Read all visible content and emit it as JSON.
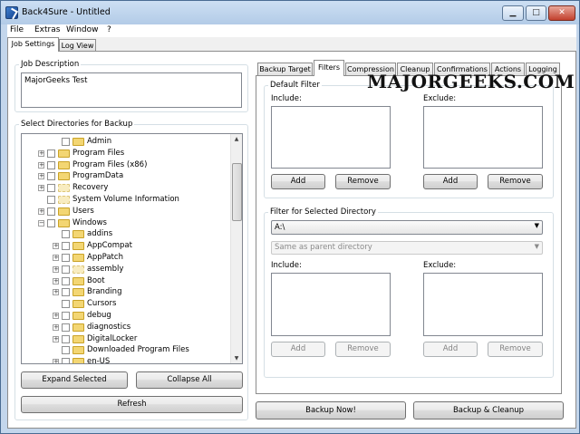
{
  "window": {
    "title": "Back4Sure - Untitled",
    "controls": {
      "minimize": "▁",
      "maximize": "□",
      "close": "✕"
    }
  },
  "menu": [
    "File",
    "Extras",
    "Window",
    "?"
  ],
  "watermark": "MAJORGEEKS.COM",
  "main_tabs": [
    {
      "label": "Job Settings",
      "active": true
    },
    {
      "label": "Log View",
      "active": false
    }
  ],
  "job_description": {
    "label": "Job Description",
    "value": "MajorGeeks Test"
  },
  "directories": {
    "label": "Select Directories for Backup",
    "tree": [
      {
        "name": "Admin",
        "indent": 1,
        "expander": "",
        "faded": false
      },
      {
        "name": "Program Files",
        "indent": 0,
        "expander": "+",
        "faded": false
      },
      {
        "name": "Program Files (x86)",
        "indent": 0,
        "expander": "+",
        "faded": false
      },
      {
        "name": "ProgramData",
        "indent": 0,
        "expander": "+",
        "faded": false
      },
      {
        "name": "Recovery",
        "indent": 0,
        "expander": "+",
        "faded": true
      },
      {
        "name": "System Volume Information",
        "indent": 0,
        "expander": "",
        "faded": true
      },
      {
        "name": "Users",
        "indent": 0,
        "expander": "+",
        "faded": false
      },
      {
        "name": "Windows",
        "indent": 0,
        "expander": "−",
        "faded": false
      },
      {
        "name": "addins",
        "indent": 1,
        "expander": "",
        "faded": false
      },
      {
        "name": "AppCompat",
        "indent": 1,
        "expander": "+",
        "faded": false
      },
      {
        "name": "AppPatch",
        "indent": 1,
        "expander": "+",
        "faded": false
      },
      {
        "name": "assembly",
        "indent": 1,
        "expander": "+",
        "faded": true
      },
      {
        "name": "Boot",
        "indent": 1,
        "expander": "+",
        "faded": false
      },
      {
        "name": "Branding",
        "indent": 1,
        "expander": "+",
        "faded": false
      },
      {
        "name": "Cursors",
        "indent": 1,
        "expander": "",
        "faded": false
      },
      {
        "name": "debug",
        "indent": 1,
        "expander": "+",
        "faded": false
      },
      {
        "name": "diagnostics",
        "indent": 1,
        "expander": "+",
        "faded": false
      },
      {
        "name": "DigitalLocker",
        "indent": 1,
        "expander": "+",
        "faded": false
      },
      {
        "name": "Downloaded Program Files",
        "indent": 1,
        "expander": "",
        "faded": false
      },
      {
        "name": "en-US",
        "indent": 1,
        "expander": "+",
        "faded": false
      }
    ],
    "expand_button": "Expand Selected",
    "collapse_button": "Collapse All",
    "refresh_button": "Refresh"
  },
  "settings_tabs": [
    {
      "label": "Backup Target",
      "active": false
    },
    {
      "label": "Filters",
      "active": true
    },
    {
      "label": "Compression",
      "active": false
    },
    {
      "label": "Cleanup",
      "active": false
    },
    {
      "label": "Confirmations",
      "active": false
    },
    {
      "label": "Actions",
      "active": false
    },
    {
      "label": "Logging",
      "active": false
    }
  ],
  "default_filter": {
    "label": "Default Filter",
    "include_label": "Include:",
    "exclude_label": "Exclude:",
    "add": "Add",
    "remove": "Remove"
  },
  "dir_filter": {
    "label": "Filter for Selected Directory",
    "directory": "A:\\",
    "mode": "Same as parent directory",
    "include_label": "Include:",
    "exclude_label": "Exclude:",
    "add": "Add",
    "remove": "Remove"
  },
  "actions": {
    "backup_now": "Backup Now!",
    "backup_cleanup": "Backup & Cleanup"
  }
}
